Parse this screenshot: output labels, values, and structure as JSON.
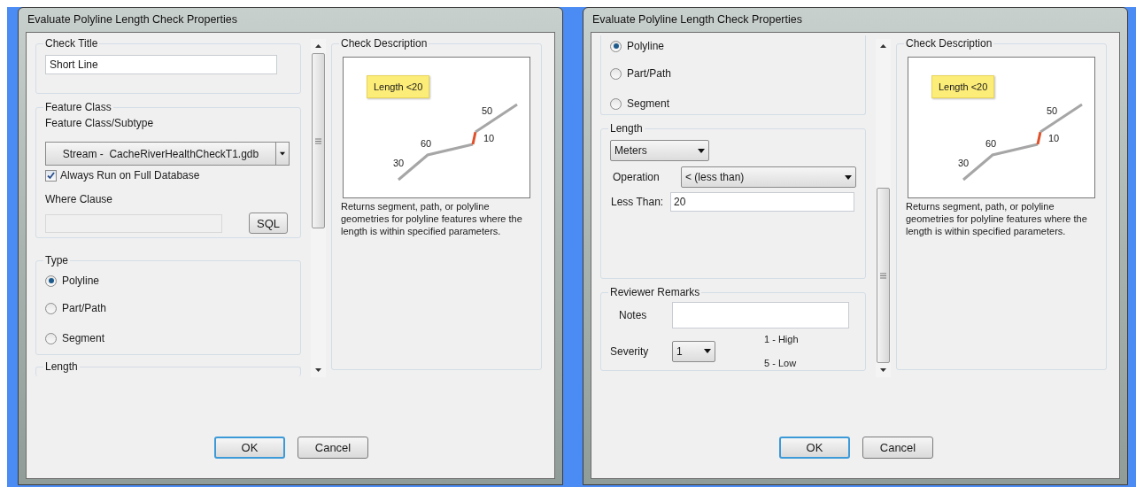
{
  "dialogs": [
    {
      "title": "Evaluate Polyline Length Check Properties",
      "sections": [
        {
          "kind": "text_field",
          "title": "Check Title",
          "value": "Short Line"
        },
        {
          "kind": "feature_class",
          "title": "Feature Class",
          "label": "Feature Class/Subtype",
          "dropdown": "Stream -  CacheRiverHealthCheckT1.gdb",
          "checkbox": {
            "label": "Always Run on Full Database",
            "checked": true
          },
          "where_label": "Where Clause",
          "where_disabled": true,
          "button": "SQL"
        },
        {
          "kind": "radio_group",
          "title": "Type",
          "options": [
            {
              "label": "Polyline",
              "selected": true
            },
            {
              "label": "Part/Path",
              "selected": false
            },
            {
              "label": "Segment",
              "selected": false
            }
          ]
        },
        {
          "kind": "length",
          "title": "Length"
        }
      ],
      "description": {
        "title": "Check Description",
        "callout": "Length <20",
        "labels": [
          "30",
          "60",
          "10",
          "50"
        ],
        "text": "Returns segment, path, or polyline geometries for polyline features where the length is within specified parameters."
      },
      "buttons": [
        {
          "label": "OK",
          "default": true
        },
        {
          "label": "Cancel",
          "default": false
        }
      ]
    },
    {
      "title": "Evaluate Polyline Length Check Properties",
      "sections": [
        {
          "kind": "radio_group",
          "options": [
            {
              "label": "Polyline",
              "selected": true
            },
            {
              "label": "Part/Path",
              "selected": false
            },
            {
              "label": "Segment",
              "selected": false
            }
          ]
        },
        {
          "kind": "length",
          "title": "Length",
          "unit": "Meters",
          "operation_label": "Operation",
          "operation": "< (less than)",
          "value_label": "Less Than:",
          "value": "20"
        },
        {
          "kind": "remarks",
          "title": "Reviewer Remarks",
          "notes_label": "Notes",
          "severity_label": "Severity",
          "severity": "1",
          "scale": [
            "1 - High",
            "5 - Low"
          ]
        }
      ],
      "description": {
        "title": "Check Description",
        "callout": "Length <20",
        "labels": [
          "30",
          "60",
          "10",
          "50"
        ],
        "text": "Returns segment, path, or polyline geometries for polyline features where the length is within specified parameters."
      },
      "buttons": [
        {
          "label": "OK",
          "default": true
        },
        {
          "label": "Cancel",
          "default": false
        }
      ]
    }
  ]
}
